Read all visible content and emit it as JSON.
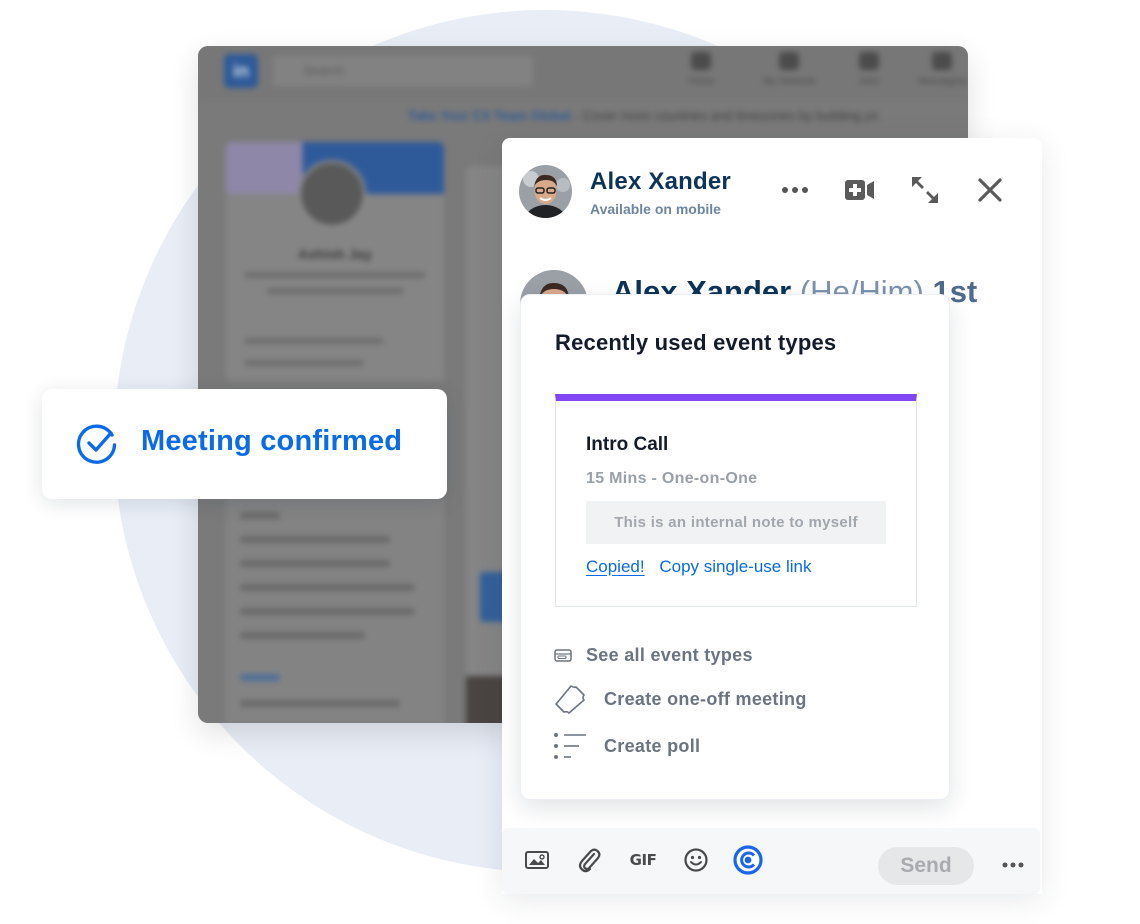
{
  "background": {
    "app_logo": "in",
    "search_placeholder": "Search",
    "nav_items": [
      "Home",
      "My Network",
      "Jobs",
      "Messaging"
    ],
    "banner_link": "Take Your CX Team Global",
    "banner_text": "- Cover more countries and timezones by building yo",
    "profile_name": "Ashish Jay"
  },
  "chat": {
    "contact_name": "Alex Xander",
    "contact_status": "Available on mobile",
    "profile_name": "Alex Xander",
    "profile_pronouns": "(He/Him)",
    "profile_degree": "1st",
    "header_actions": {
      "more": "more-options-icon",
      "video": "video-call-icon",
      "expand": "expand-icon",
      "close": "close-icon"
    }
  },
  "popover": {
    "title": "Recently used event types",
    "accent_color": "#8247f5",
    "event": {
      "name": "Intro Call",
      "meta": "15 Mins - One-on-One",
      "note": "This is an internal note to myself",
      "copied_label": "Copied!",
      "copy_single_use_label": "Copy single-use link"
    },
    "menu": [
      {
        "icon": "event-types-icon",
        "label": "See all event types"
      },
      {
        "icon": "ticket-icon",
        "label": "Create one-off meeting"
      },
      {
        "icon": "poll-list-icon",
        "label": "Create poll"
      }
    ]
  },
  "composer": {
    "tools": [
      "image-icon",
      "attachment-icon",
      "gif-icon",
      "emoji-icon",
      "calendly-icon"
    ],
    "gif_label": "GIF",
    "send_label": "Send",
    "more": "more-options-icon"
  },
  "toast": {
    "text": "Meeting confirmed",
    "color": "#0b6be6"
  }
}
